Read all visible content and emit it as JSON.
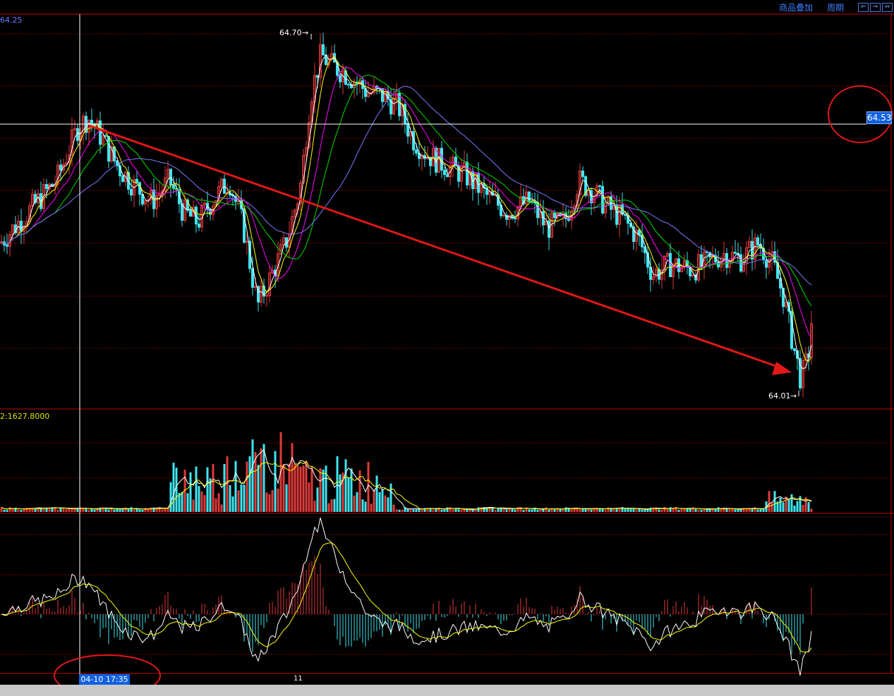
{
  "toolbar": {
    "overlay_label": "商品叠加",
    "period_label": "周期",
    "nav_buttons": [
      "⇐",
      "⇒",
      "⇔"
    ]
  },
  "price_panel": {
    "top_value_label": "64.25",
    "high_label": "64.70",
    "low_label": "64.01",
    "crosshair_price": "64.53"
  },
  "volume_panel": {
    "value_label": "2:1627.8000"
  },
  "time_axis": {
    "crosshair_time": "04-10 17:35",
    "tick_label": "11"
  },
  "colors": {
    "up": "#e03a3a",
    "down": "#3ee6f0",
    "ma5": "#ffffff",
    "ma10": "#ffff00",
    "ma20": "#ff00ff",
    "ma30": "#00dd00",
    "ma60": "#7a7aff",
    "grid": "#7a0000",
    "divider": "#c00000",
    "annotation": "#e01818"
  },
  "chart_data": {
    "type": "candlestick",
    "y_markers": {
      "high": 64.7,
      "low": 64.01,
      "crosshair": 64.53
    },
    "candles_approx": [
      [
        "o",
        64.35,
        "c",
        64.39
      ],
      [
        "o",
        64.39,
        "c",
        64.42
      ],
      [
        "o",
        64.42,
        "c",
        64.45
      ],
      [
        "o",
        64.45,
        "c",
        64.51
      ],
      [
        "o",
        64.51,
        "c",
        64.54
      ],
      [
        "o",
        64.54,
        "c",
        64.49
      ],
      [
        "o",
        64.49,
        "c",
        64.43
      ],
      [
        "o",
        64.43,
        "c",
        64.4
      ],
      [
        "o",
        64.4,
        "c",
        64.38
      ],
      [
        "o",
        64.38,
        "c",
        64.41
      ],
      [
        "o",
        64.41,
        "c",
        64.39
      ],
      [
        "o",
        64.39,
        "c",
        64.36
      ],
      [
        "o",
        64.36,
        "c",
        64.4
      ],
      [
        "o",
        64.4,
        "c",
        64.43
      ],
      [
        "o",
        64.43,
        "c",
        64.38
      ],
      [
        "o",
        64.38,
        "c",
        64.31
      ],
      [
        "o",
        64.31,
        "c",
        64.22
      ],
      [
        "o",
        64.22,
        "c",
        64.28
      ],
      [
        "o",
        64.28,
        "c",
        64.34
      ],
      [
        "o",
        64.34,
        "c",
        64.52
      ],
      [
        "o",
        64.52,
        "c",
        64.66
      ],
      [
        "o",
        64.66,
        "c",
        64.63
      ],
      [
        "o",
        64.63,
        "c",
        64.6
      ],
      [
        "o",
        64.6,
        "c",
        64.57
      ],
      [
        "o",
        64.57,
        "c",
        64.5
      ],
      [
        "o",
        64.5,
        "c",
        64.47
      ],
      [
        "o",
        64.47,
        "c",
        64.45
      ],
      [
        "o",
        64.45,
        "c",
        64.43
      ],
      [
        "o",
        64.43,
        "c",
        64.41
      ],
      [
        "o",
        64.41,
        "c",
        64.39
      ],
      [
        "o",
        64.39,
        "c",
        64.4
      ],
      [
        "o",
        64.4,
        "c",
        64.44
      ],
      [
        "o",
        64.44,
        "c",
        64.41
      ],
      [
        "o",
        64.41,
        "c",
        64.38
      ],
      [
        "o",
        64.38,
        "c",
        64.37
      ],
      [
        "o",
        64.37,
        "c",
        64.33
      ],
      [
        "o",
        64.33,
        "c",
        64.32
      ],
      [
        "o",
        64.32,
        "c",
        64.34
      ],
      [
        "o",
        64.34,
        "c",
        64.33
      ],
      [
        "o",
        64.33,
        "c",
        64.32
      ],
      [
        "o",
        64.32,
        "c",
        64.35
      ],
      [
        "o",
        64.35,
        "c",
        64.34
      ],
      [
        "o",
        64.34,
        "c",
        64.31
      ],
      [
        "o",
        64.31,
        "c",
        64.22
      ],
      [
        "o",
        64.22,
        "c",
        64.05
      ],
      [
        "o",
        64.05,
        "c",
        64.17
      ]
    ],
    "volume_approx": [
      3,
      3,
      3,
      4,
      4,
      4,
      4,
      5,
      6,
      9,
      14,
      16,
      22,
      28,
      24,
      20,
      26,
      14,
      10,
      8,
      3,
      2,
      2,
      2,
      1,
      1,
      1,
      1,
      1,
      1,
      1,
      1,
      1,
      1,
      2,
      2,
      2,
      2,
      2,
      2,
      3,
      4,
      4,
      5,
      6,
      7
    ],
    "macd_approx": [
      0.5,
      0.8,
      1.3,
      1.0,
      0.4,
      -0.6,
      -0.9,
      -0.4,
      0.2,
      0.5,
      -0.6,
      -1.2,
      -0.2,
      1.3,
      2.5,
      2.1,
      0.9,
      -0.3,
      -0.8,
      -1.0,
      -0.9,
      -0.6,
      -0.4,
      -0.2,
      0.1,
      0.5,
      0.6,
      0.2,
      -0.5,
      -0.8,
      -0.3,
      0.2,
      0.4,
      0.4,
      0.3,
      0.5,
      0.4,
      0.6,
      0.6,
      0.3,
      -0.2,
      -1.0,
      -1.8
    ]
  }
}
